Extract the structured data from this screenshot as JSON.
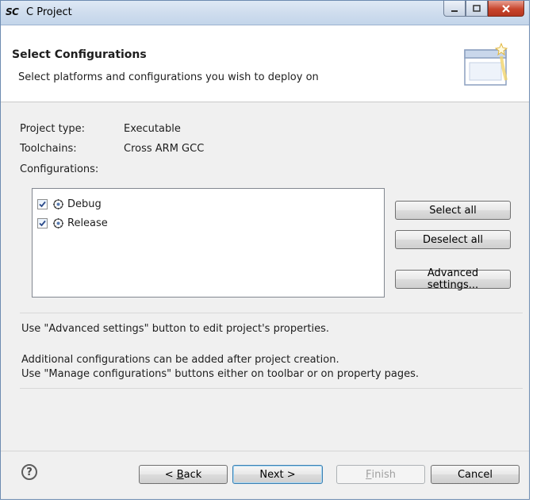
{
  "window": {
    "logo": "SC",
    "title": "C Project"
  },
  "header": {
    "title": "Select Configurations",
    "description": "Select platforms and configurations you wish to deploy on"
  },
  "info": {
    "project_type_label": "Project type:",
    "project_type_value": "Executable",
    "toolchains_label": "Toolchains:",
    "toolchains_value": "Cross ARM GCC",
    "configurations_label": "Configurations:"
  },
  "configurations": [
    {
      "label": "Debug",
      "checked": true
    },
    {
      "label": "Release",
      "checked": true
    }
  ],
  "side_buttons": {
    "select_all": "Select all",
    "deselect_all": "Deselect all",
    "advanced": "Advanced settings..."
  },
  "notes": {
    "line1": "Use \"Advanced settings\" button to edit project's properties.",
    "line2": "Additional configurations can be added after project creation.",
    "line3": "Use \"Manage configurations\" buttons either on toolbar or on property pages."
  },
  "footer": {
    "back_prefix": "< ",
    "back_mnemonic": "B",
    "back_rest": "ack",
    "next": "Next >",
    "finish_mnemonic": "F",
    "finish_rest": "inish",
    "cancel": "Cancel"
  },
  "icons": {
    "help": "help-icon",
    "wizard": "wizard-banner-icon",
    "config": "gear-icon"
  }
}
